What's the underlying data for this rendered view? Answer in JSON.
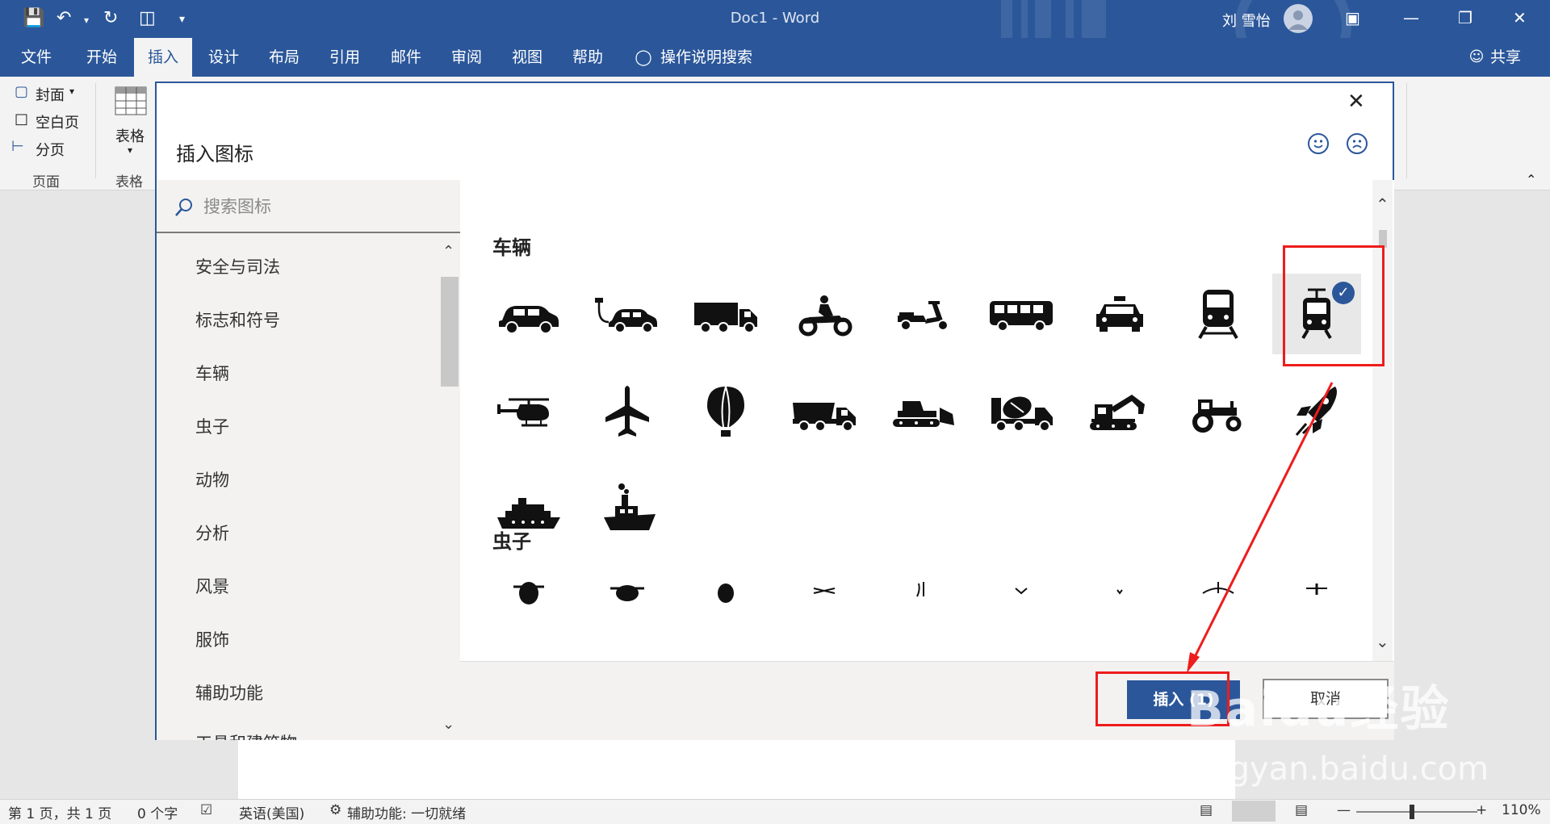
{
  "window": {
    "doc_title": "Doc1  -  Word",
    "user_name": "刘 雪怡"
  },
  "tabs": [
    "文件",
    "开始",
    "插入",
    "设计",
    "布局",
    "引用",
    "邮件",
    "审阅",
    "视图",
    "帮助",
    "操作说明搜索"
  ],
  "active_tab": "插入",
  "share_label": "共享",
  "ribbon": {
    "cover_label": "封面",
    "blank_label": "空白页",
    "break_label": "分页",
    "group_pages": "页面",
    "table_label": "表格",
    "group_tables": "表格"
  },
  "dialog": {
    "title": "插入图标",
    "search_placeholder": "搜索图标",
    "categories": [
      "安全与司法",
      "标志和符号",
      "车辆",
      "虫子",
      "动物",
      "分析",
      "风景",
      "服饰",
      "辅助功能",
      "工具和建筑物"
    ],
    "section_vehicles": "车辆",
    "section_bugs": "虫子",
    "vehicle_icons": [
      "car-icon",
      "electric-car-icon",
      "truck-icon",
      "motorcycle-icon",
      "scooter-icon",
      "bus-icon",
      "taxi-icon",
      "train-icon",
      "tram-icon",
      "helicopter-icon",
      "airplane-icon",
      "hot-air-balloon-icon",
      "dump-truck-icon",
      "bulldozer-icon",
      "cement-mixer-icon",
      "excavator-icon",
      "tractor-icon",
      "rocket-icon",
      "cruise-ship-icon",
      "tugboat-icon"
    ],
    "selected_icon": "tram-icon",
    "insert_label": "插入 (1)",
    "cancel_label": "取消"
  },
  "statusbar": {
    "page_info": "第 1 页，共 1 页",
    "word_count": "0 个字",
    "language": "英语(美国)",
    "accessibility": "辅助功能: 一切就绪",
    "zoom": "110%"
  },
  "watermark": {
    "brand": "Baidu经验",
    "url": "jingyan.baidu.com"
  },
  "colors": {
    "accent": "#2b579a",
    "annotation": "#ee1c1c"
  }
}
